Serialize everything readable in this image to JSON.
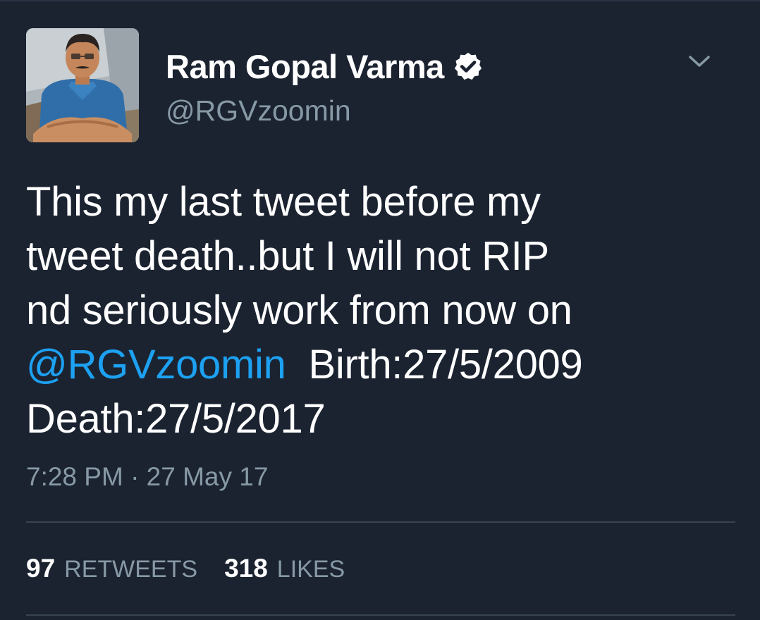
{
  "author": {
    "display_name": "Ram Gopal Varma",
    "handle": "@RGVzoomin",
    "verified": true,
    "avatar_icon": "profile-photo"
  },
  "tweet": {
    "lines": [
      "This my last tweet before my",
      "tweet death..but I will not RIP",
      "nd seriously work from now on"
    ],
    "mention": "@RGVzoomin",
    "birth_text": "Birth:27/5/2009",
    "death_text": "Death:27/5/2017",
    "timestamp": "7:28 PM · 27 May 17"
  },
  "stats": {
    "retweets_count": "97",
    "retweets_label": "RETWEETS",
    "likes_count": "318",
    "likes_label": "LIKES"
  },
  "colors": {
    "background": "#1b2331",
    "primary_text": "#ffffff",
    "secondary_text": "#8899a6",
    "link": "#1da1f2",
    "divider": "#38444d"
  },
  "icons": {
    "verified": "verified-badge-icon",
    "menu": "chevron-down-icon"
  }
}
